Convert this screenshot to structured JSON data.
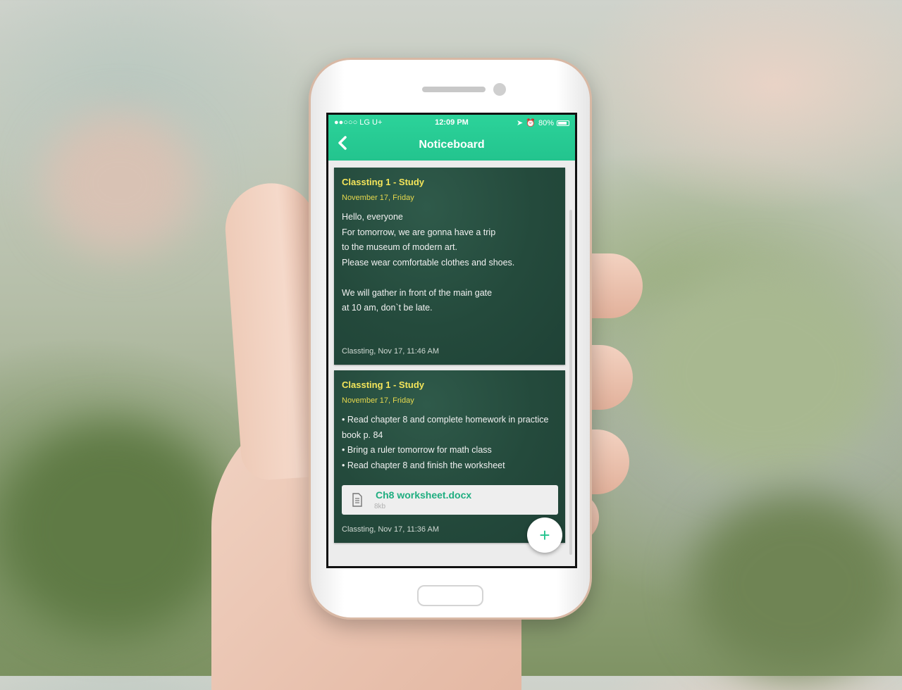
{
  "status_bar": {
    "carrier": "●●○○○ LG U+",
    "time": "12:09 PM",
    "battery": "80%"
  },
  "header": {
    "title": "Noticeboard"
  },
  "notices": [
    {
      "title": "Classting 1 - Study",
      "date": "November 17, Friday",
      "body": [
        "Hello, everyone",
        "For tomorrow, we are gonna have a trip",
        "to the museum of modern art.",
        "Please wear comfortable clothes and shoes.",
        "",
        "We will gather in front of the main gate",
        "at 10 am, don`t be late."
      ],
      "footer": "Classting, Nov 17, 11:46 AM"
    },
    {
      "title": "Classting 1 - Study",
      "date": "November 17, Friday",
      "body": [
        "• Read chapter 8 and complete homework in practice",
        "book p. 84",
        "• Bring a ruler tomorrow for math class",
        "• Read chapter 8 and finish the worksheet"
      ],
      "attachment": {
        "name": "Ch8 worksheet.docx",
        "size": "8kb"
      },
      "footer": "Classting, Nov 17, 11:36 AM"
    }
  ],
  "fab_label": "+",
  "colors": {
    "accent": "#23c48e",
    "card_background": "#244a3c",
    "card_title": "#f4e55a"
  }
}
